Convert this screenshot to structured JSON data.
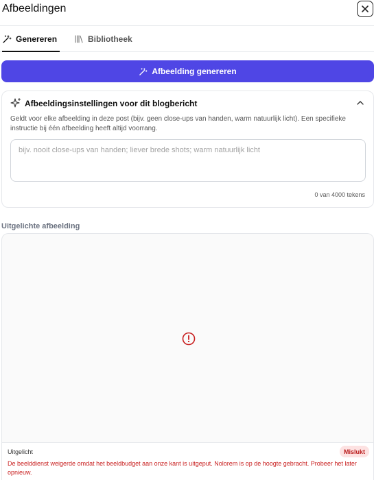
{
  "header": {
    "title": "Afbeeldingen"
  },
  "tabs": [
    {
      "label": "Genereren",
      "icon": "magic-wand-icon",
      "active": true
    },
    {
      "label": "Bibliotheek",
      "icon": "library-icon",
      "active": false
    }
  ],
  "generate_button": {
    "label": "Afbeelding genereren",
    "icon": "magic-wand-icon",
    "color": "#4f46e5"
  },
  "settings": {
    "title": "Afbeeldingsinstellingen voor dit blogbericht",
    "description": "Geldt voor elke afbeelding in deze post (bijv. geen close-ups van handen, warm natuurlijk licht). Een specifieke instructie bij één afbeelding heeft altijd voorrang.",
    "input_value": "",
    "placeholder": "bijv. nooit close-ups van handen; liever brede shots; warm natuurlijk licht",
    "counter": "0 van 4000 tekens"
  },
  "featured": {
    "section_label": "Uitgelichte afbeelding",
    "card_label": "Uitgelicht",
    "status_badge": "Mislukt",
    "error_message": "De beelddienst weigerde omdat het beeldbudget aan onze kant is uitgeput. Nolorem is op de hoogte gebracht. Probeer het later opnieuw.",
    "error_color": "#c81e1e"
  }
}
